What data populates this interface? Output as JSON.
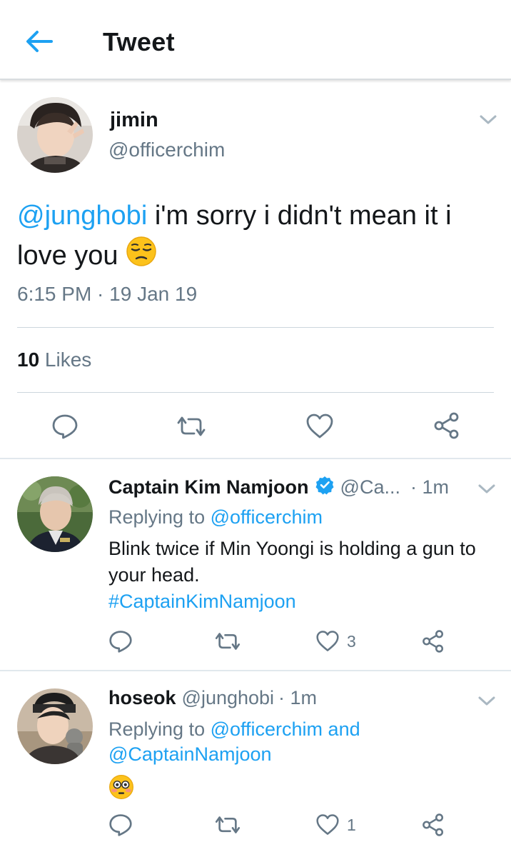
{
  "header": {
    "title": "Tweet"
  },
  "main_tweet": {
    "name": "jimin",
    "handle": "@officerchim",
    "mention": "@junghobi",
    "text": " i'm sorry i didn't mean it i love you ",
    "emoji": "pensive-face",
    "timestamp": "6:15 PM · 19 Jan 19",
    "likes_count": "10",
    "likes_label": " Likes"
  },
  "replies": [
    {
      "name": "Captain Kim Namjoon",
      "verified": true,
      "handle": "@Ca...",
      "time": "· 1m",
      "replying_prefix": "Replying to ",
      "replying_to": "@officerchim",
      "text": "Blink twice if Min Yoongi is holding a gun to your head.",
      "hashtag": "#CaptainKimNamjoon",
      "like_count": "3"
    },
    {
      "name": "hoseok",
      "handle": "@junghobi",
      "time": "· 1m",
      "replying_prefix": "Replying to ",
      "replying_to": "@officerchim and",
      "replying_to_2": "@CaptainNamjoon",
      "emoji": "flushed-face",
      "like_count": "1"
    }
  ],
  "colors": {
    "accent": "#1da1f2",
    "muted": "#657786",
    "text": "#14171a",
    "divider": "#e1e8ed"
  }
}
